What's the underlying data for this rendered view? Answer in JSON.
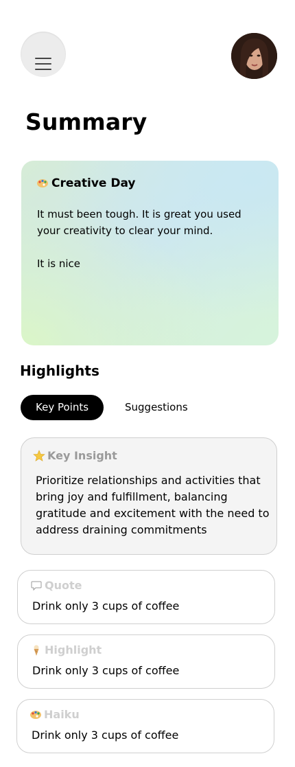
{
  "header": {
    "menu_icon": "hamburger-menu-icon",
    "avatar": "user-avatar"
  },
  "page": {
    "title": "Summary"
  },
  "summary_card": {
    "icon": "palette-icon",
    "title": "Creative Day",
    "text": "It must been tough. It is great you  used your creativity to clear your mind.\n\nIt is nice"
  },
  "highlights": {
    "title": "Highlights",
    "tabs": [
      {
        "label": "Key Points",
        "active": true
      },
      {
        "label": "Suggestions",
        "active": false
      }
    ]
  },
  "insight": {
    "icon": "star-icon",
    "title": "Key Insight",
    "text": "Prioritize relationships and activities that bring joy and fulfillment, balancing gratitude and excitement with the need to address draining commitments"
  },
  "cards": [
    {
      "icon": "speech-bubble-icon",
      "title": "Quote",
      "text": "Drink only 3 cups of coffee"
    },
    {
      "icon": "ice-cream-icon",
      "title": "Highlight",
      "text": "Drink only 3 cups of coffee"
    },
    {
      "icon": "palette-icon",
      "title": "Haiku",
      "text": "Drink only 3 cups of coffee"
    }
  ],
  "colors": {
    "tab_active_bg": "#000000",
    "tab_active_text": "#ffffff",
    "insight_bg": "#f4f4f4",
    "muted_title": "#9a9a9a"
  }
}
